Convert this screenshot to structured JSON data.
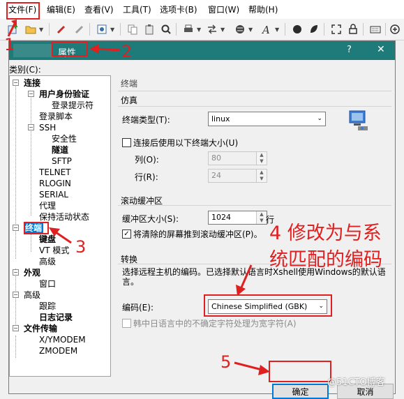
{
  "menu": [
    "文件(F)",
    "编辑(E)",
    "查看(V)",
    "工具(T)",
    "选项卡(B)",
    "窗口(W)",
    "帮助(H)"
  ],
  "dialog": {
    "title": "属性",
    "help_glyph": "?",
    "close_glyph": "✕",
    "category_label": "类别(C):"
  },
  "tree": {
    "connection": "连接",
    "auth": "用户身份验证",
    "login_prompt": "登录提示符",
    "login_script": "登录脚本",
    "ssh": "SSH",
    "security": "安全性",
    "tunnel": "隧道",
    "sftp": "SFTP",
    "telnet": "TELNET",
    "rlogin": "RLOGIN",
    "serial": "SERIAL",
    "proxy": "代理",
    "keepalive": "保持活动状态",
    "terminal": "终端",
    "keyboard": "键盘",
    "vt_mode": "VT 模式",
    "advanced1": "高级",
    "appearance": "外观",
    "window": "窗口",
    "advanced2": "高级",
    "trace": "跟踪",
    "logging": "日志记录",
    "filetransfer": "文件传输",
    "xymodem": "X/YMODEM",
    "zmodem": "ZMODEM"
  },
  "panel": {
    "header": "终端",
    "emulation": {
      "group": "仿真",
      "type_label": "终端类型(T):",
      "type_value": "linux",
      "use_size_label": "连接后使用以下终端大小(U)",
      "use_size_checked": false,
      "cols_label": "列(O):",
      "cols_value": "80",
      "rows_label": "行(R):",
      "rows_value": "24"
    },
    "scrollback": {
      "group": "滚动缓冲区",
      "size_label": "缓冲区大小(S):",
      "size_value": "1024",
      "size_unit": "行",
      "push_label": "将清除的屏幕推到滚动缓冲区(P)。",
      "push_checked": true
    },
    "translation": {
      "group": "转换",
      "desc": "选择远程主机的编码。已选择默认语言时Xshell使用Windows的默认语言。",
      "encoding_label": "编码(E):",
      "encoding_value": "Chinese Simplified (GBK)",
      "cjk_label": "韩中日语言中的不确定字符处理为宽字符(A)",
      "cjk_checked": false
    }
  },
  "buttons": {
    "ok": "确定",
    "cancel": "取消"
  },
  "annotations": {
    "n1": "1",
    "n2": "2",
    "n3": "3",
    "n5": "5",
    "n4_text_line1": "4 修改为与系",
    "n4_text_line2": "统匹配的编码"
  },
  "watermark": "@51CTO博客",
  "colors": {
    "accent_red": "#e02020",
    "titlebar": "#1f7a7a",
    "selection": "#0078d7"
  }
}
